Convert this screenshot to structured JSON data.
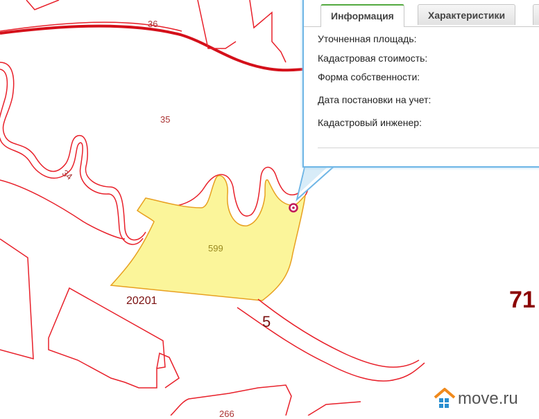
{
  "map": {
    "labels": {
      "parcel_36": "36",
      "parcel_35": "35",
      "parcel_34": "34",
      "parcel_599": "599",
      "quarter_20201": "20201",
      "block_5": "5",
      "block_71": "71",
      "parcel_266": "266"
    },
    "colors": {
      "boundary": "#e8202a",
      "boundary_thick": "#d4101a",
      "selected_fill": "#fbf59a",
      "selected_stroke": "#e8a020",
      "marker": "#c0185a"
    }
  },
  "popup": {
    "tabs": [
      {
        "label": "Информация",
        "active": true
      },
      {
        "label": "Характеристики",
        "active": false
      }
    ],
    "fields": [
      "Уточненная площадь:",
      "Кадастровая стоимость:",
      "Форма собственности:",
      "Дата постановки на учет:",
      "Кадастровый инженер:"
    ]
  },
  "watermark": {
    "text": "move.ru",
    "icon": "house-logo-icon"
  }
}
